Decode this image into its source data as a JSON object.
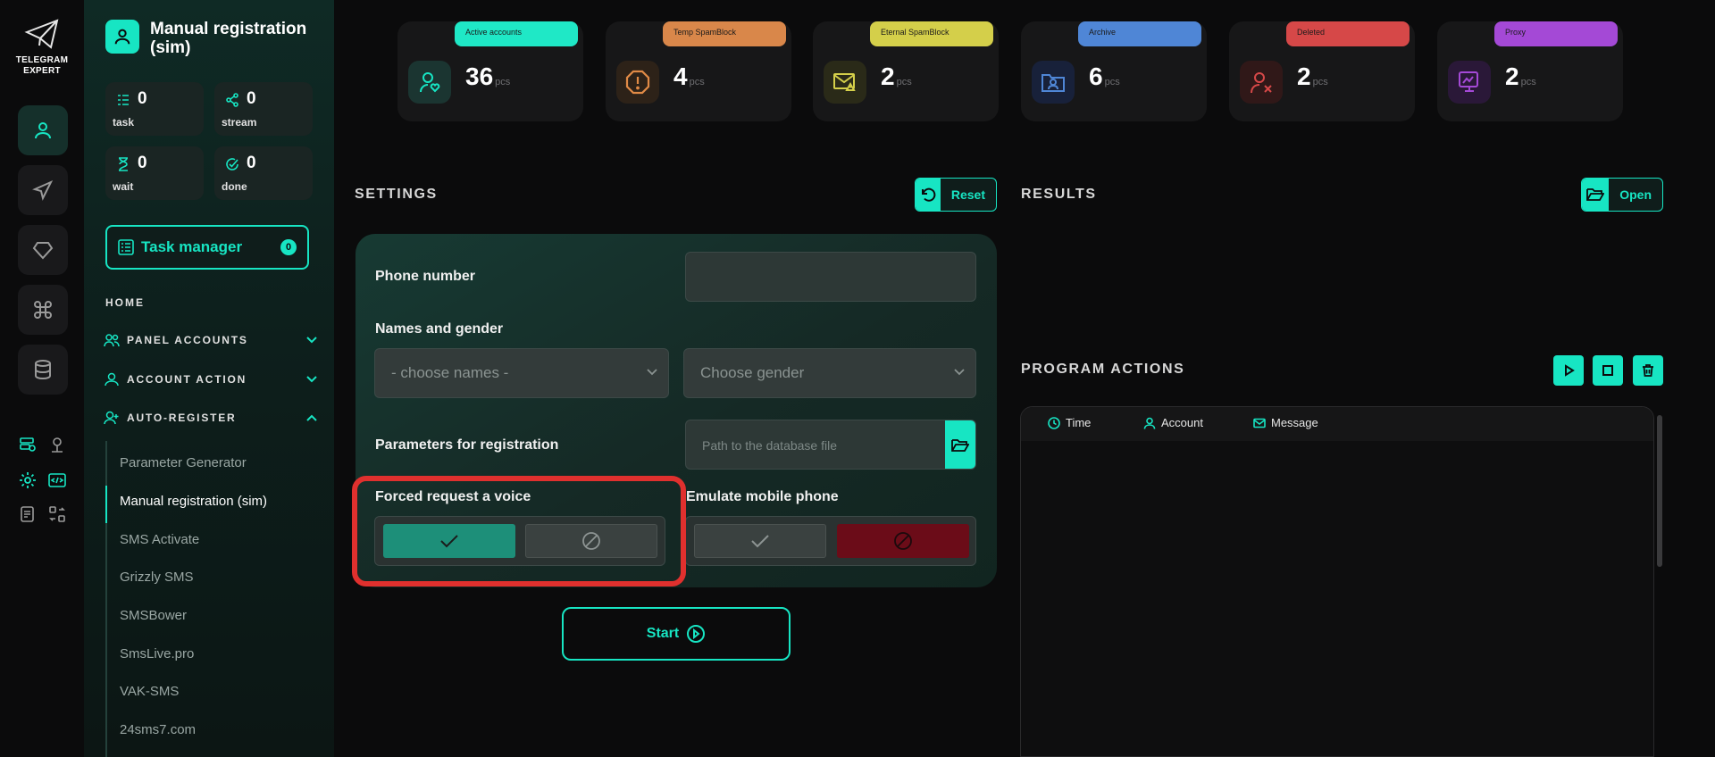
{
  "app": {
    "logo_text_1": "TELEGRAM",
    "logo_text_2": "EXPERT"
  },
  "sidebar": {
    "title": "Manual registration (sim)",
    "stats": [
      {
        "value": "0",
        "label": "task",
        "icon": "task-list-icon"
      },
      {
        "value": "0",
        "label": "stream",
        "icon": "share-icon"
      },
      {
        "value": "0",
        "label": "wait",
        "icon": "hourglass-icon"
      },
      {
        "value": "0",
        "label": "done",
        "icon": "check-circle-icon"
      }
    ],
    "task_manager": {
      "label": "Task manager",
      "count": "0"
    },
    "home": "HOME",
    "sections": [
      {
        "label": "PANEL ACCOUNTS",
        "expanded": false
      },
      {
        "label": "ACCOUNT ACTION",
        "expanded": false
      },
      {
        "label": "AUTO-REGISTER",
        "expanded": true
      }
    ],
    "sub_items": [
      "Parameter Generator",
      "Manual registration (sim)",
      "SMS Activate",
      "Grizzly SMS",
      "SMSBower",
      "SmsLive.pro",
      "VAK-SMS",
      "24sms7.com"
    ],
    "active_sub_item": "Manual registration (sim)"
  },
  "cards": [
    {
      "tag": "Active accounts",
      "value": "36",
      "unit": "pcs",
      "tag_color": "#1fe8c6",
      "icon": "user-heart-icon"
    },
    {
      "tag": "Temp SpamBlock",
      "value": "4",
      "unit": "pcs",
      "tag_color": "#d9874a",
      "icon": "alert-octagon-icon"
    },
    {
      "tag": "Eternal SpamBlock",
      "value": "2",
      "unit": "pcs",
      "tag_color": "#d4cf4a",
      "icon": "mail-warning-icon"
    },
    {
      "tag": "Archive",
      "value": "6",
      "unit": "pcs",
      "tag_color": "#4f86d6",
      "icon": "folder-user-icon"
    },
    {
      "tag": "Deleted",
      "value": "2",
      "unit": "pcs",
      "tag_color": "#d64848",
      "icon": "user-x-icon"
    },
    {
      "tag": "Proxy",
      "value": "2",
      "unit": "pcs",
      "tag_color": "#a449d6",
      "icon": "proxy-screen-icon"
    }
  ],
  "settings": {
    "title": "SETTINGS",
    "reset_label": "Reset",
    "phone_label": "Phone number",
    "phone_value": "",
    "names_gender_label": "Names and gender",
    "names_placeholder": "- choose names -",
    "gender_placeholder": "Choose gender",
    "params_label": "Parameters for registration",
    "path_placeholder": "Path to the database file",
    "forced_voice_label": "Forced request a voice",
    "forced_voice_enabled": true,
    "emulate_label": "Emulate mobile phone",
    "emulate_enabled": false,
    "start_label": "Start"
  },
  "results": {
    "title": "RESULTS",
    "open_label": "Open"
  },
  "program_actions": {
    "title": "PROGRAM ACTIONS",
    "columns": [
      "Time",
      "Account",
      "Message"
    ]
  },
  "colors": {
    "accent": "#17e5c3",
    "danger": "#e0302e",
    "panel": "#173a33"
  }
}
